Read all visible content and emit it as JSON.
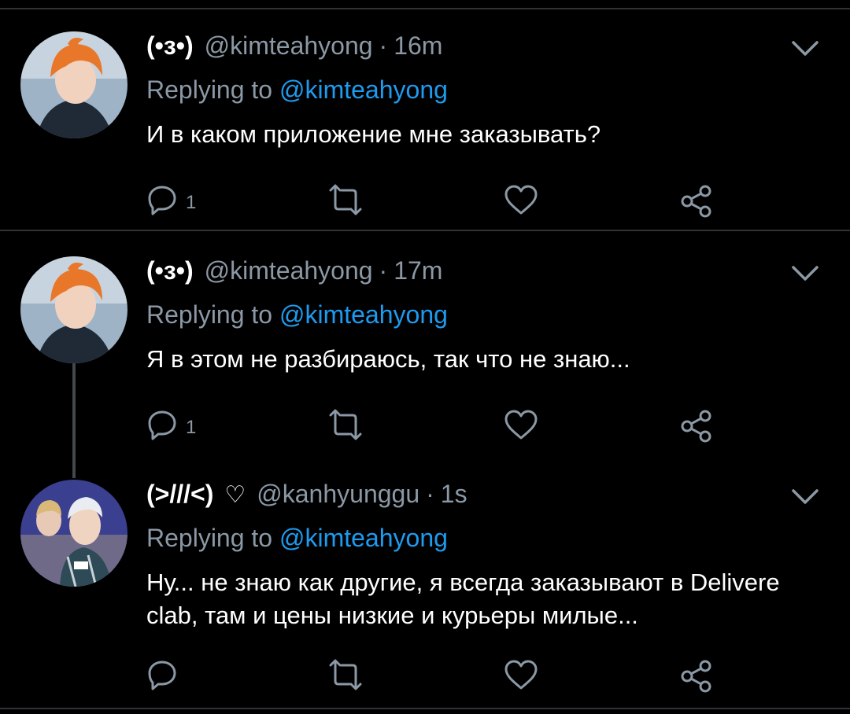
{
  "tweets": [
    {
      "name": "(•з•)",
      "handle": "@kimteahyong",
      "separator": "·",
      "time": "16m",
      "replying_label": "Replying to",
      "replying_handle": "@kimteahyong",
      "text": "И в каком приложение мне заказывать?",
      "reply_count": "1",
      "avatar": "orange-hair-avatar"
    },
    {
      "name": "(•з•)",
      "handle": "@kimteahyong",
      "separator": "·",
      "time": "17m",
      "replying_label": "Replying to",
      "replying_handle": "@kimteahyong",
      "text": "Я в этом не разбираюсь, так что не знаю...",
      "reply_count": "1",
      "avatar": "orange-hair-avatar"
    },
    {
      "name": "(>///<)",
      "name_icon": "♡",
      "handle": "@kanhyunggu",
      "separator": "·",
      "time": "1s",
      "replying_label": "Replying to",
      "replying_handle": "@kimteahyong",
      "text": "Ну... не знаю как другие, я всегда заказывают в Delivere clab, там и цены низкие и курьеры милые...",
      "reply_count": "",
      "avatar": "group-photo-avatar"
    }
  ],
  "colors": {
    "background": "#000000",
    "muted": "#8b98a5",
    "link": "#1d9bf0",
    "divider": "#2f3336"
  },
  "icons": [
    "reply-icon",
    "retweet-icon",
    "like-icon",
    "share-icon",
    "chevron-down-icon"
  ]
}
